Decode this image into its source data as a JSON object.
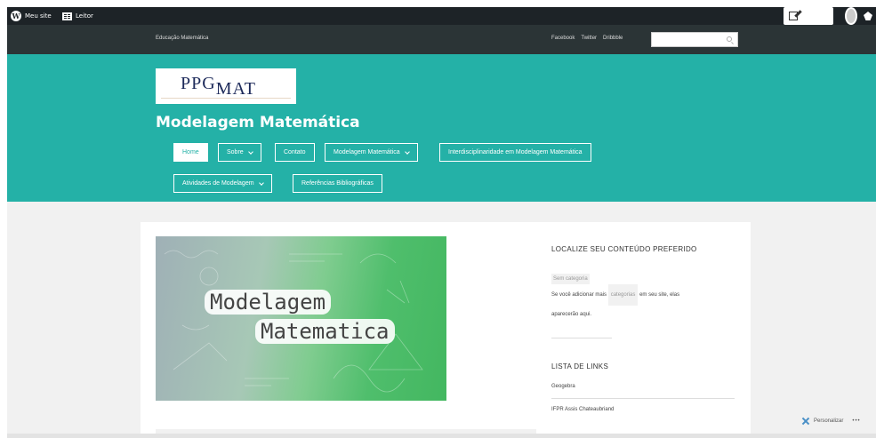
{
  "adminbar": {
    "my_site": "Meu site",
    "reader": "Leitor",
    "write": "Escrever"
  },
  "topnav": {
    "site_name": "Educação Matemática",
    "social": [
      "Facebook",
      "Twitter",
      "Dribbble"
    ],
    "search_value": ""
  },
  "header": {
    "logo_text_a": "PPG",
    "logo_text_b": "MAT",
    "site_title": "Modelagem Matemática",
    "menu": {
      "home": "Home",
      "sobre": "Sobre",
      "contato": "Contato",
      "modelagem": "Modelagem Matemática",
      "interdisciplinaridade": "Interdisciplinaridade em Modelagem Matemática",
      "atividades": "Atividades de Modelagem",
      "referencias": "Referências Bibliográficas"
    }
  },
  "featured": {
    "line1": "Modelagem",
    "line2": "Matematica"
  },
  "sidebar": {
    "widget1_title": "LOCALIZE SEU CONTEÚDO PREFERIDO",
    "category_tag": "Sem categoria",
    "text_before": "Se você adicionar mais",
    "text_link": "categorias",
    "text_after": "em seu site, elas",
    "text_line2": "aparecerão aqui.",
    "widget2_title": "LISTA DE LINKS",
    "links": [
      "Geogebra",
      "IFPR Assis Chateaubriand"
    ]
  },
  "footer": {
    "customize": "Personalizar",
    "more": "•••"
  },
  "colors": {
    "header_bg": "#24b1a7",
    "adminbar_bg": "#1d2327",
    "topnav_bg": "#2b3436"
  }
}
